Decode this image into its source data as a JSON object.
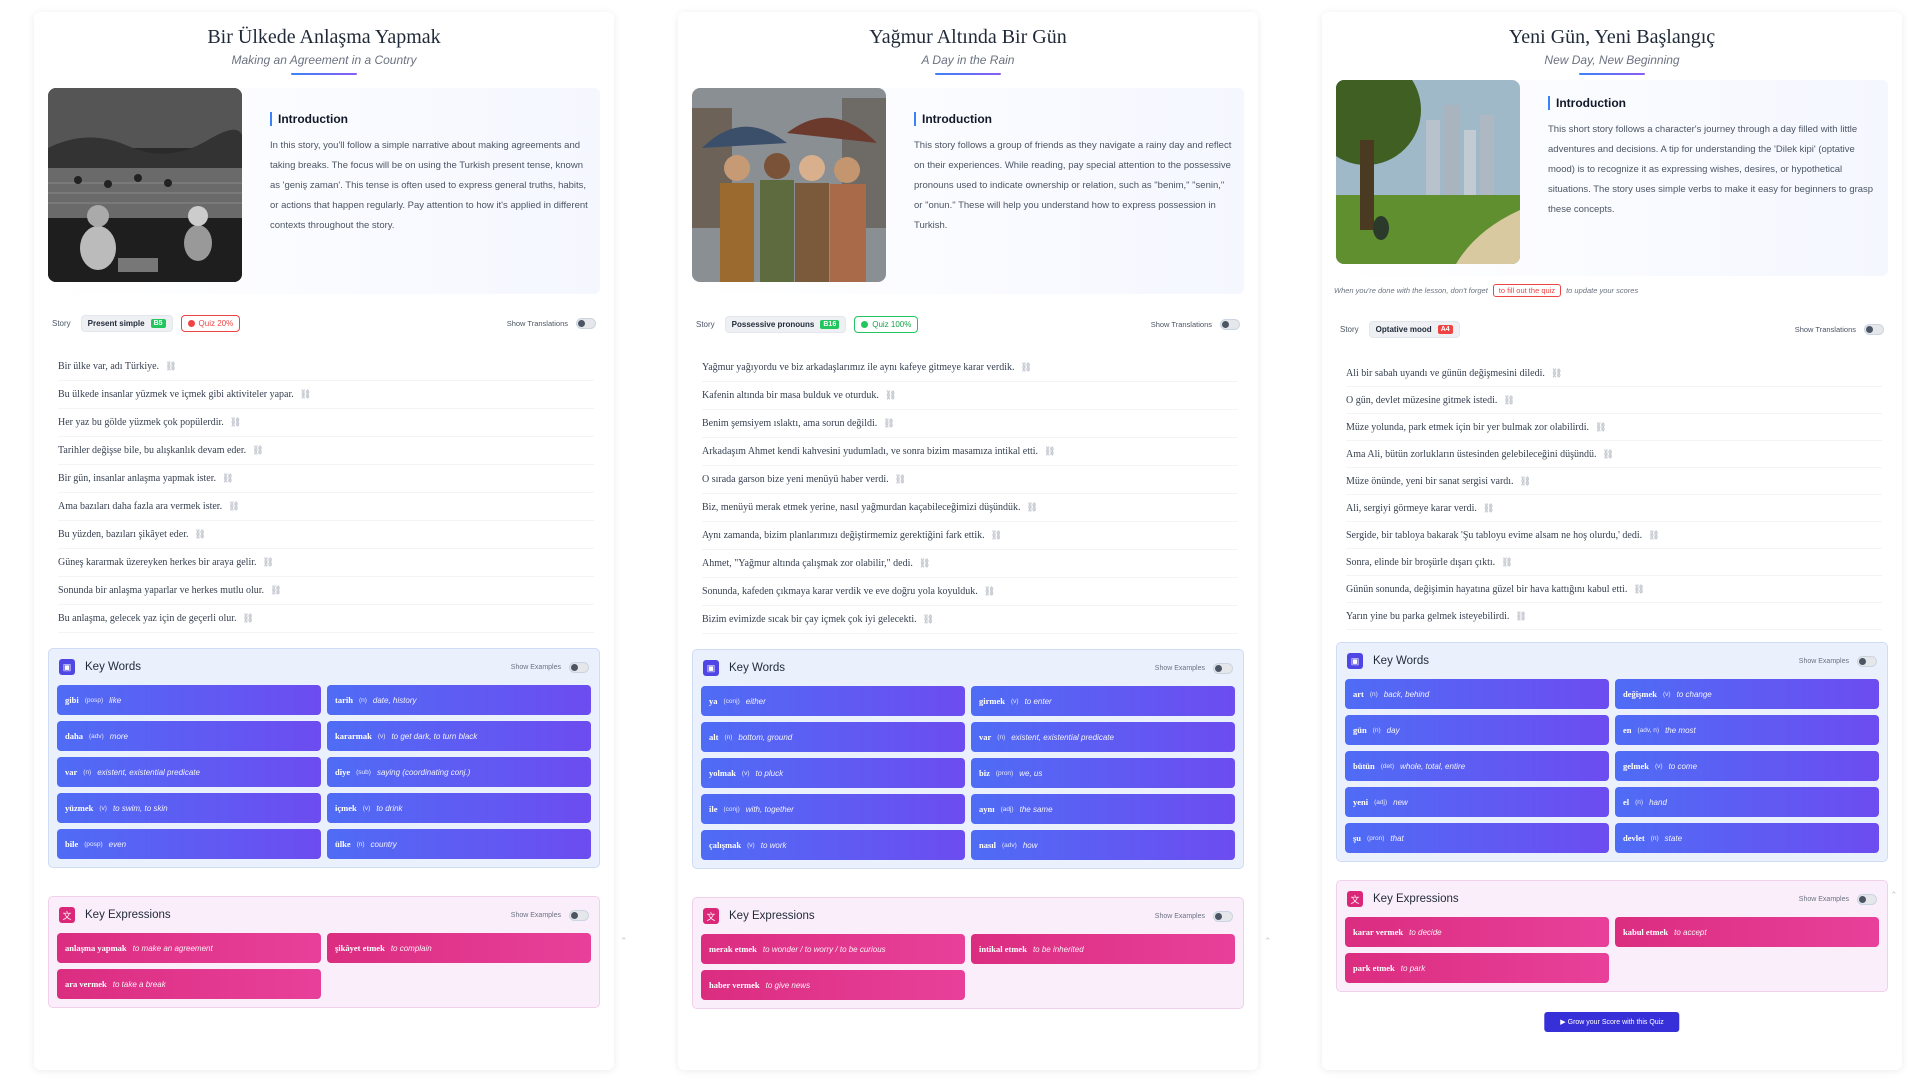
{
  "panels": [
    {
      "title": "Bir Ülkede Anlaşma Yapmak",
      "subtitle": "Making an Agreement in a Country",
      "intro_heading": "Introduction",
      "intro_text": "In this story, you'll follow a simple narrative about making agreements and taking breaks. The focus will be on using the Turkish present tense, known as 'geniş zaman'. This tense is often used to express general truths, habits, or actions that happen regularly. Pay attention to how it's applied in different contexts throughout the story.",
      "story_label": "Story",
      "grammar": "Present simple",
      "level": "B5",
      "quiz": "Quiz 20%",
      "show_translations": "Show Translations",
      "sentences": [
        "Bir ülke var, adı Türkiye.",
        "Bu ülkede insanlar yüzmek ve içmek gibi aktiviteler yapar.",
        "Her yaz bu gölde yüzmek çok popülerdir.",
        "Tarihler değişse bile, bu alışkanlık devam eder.",
        "Bir gün, insanlar anlaşma yapmak ister.",
        "Ama bazıları daha fazla ara vermek ister.",
        "Bu yüzden, bazıları şikâyet eder.",
        "Güneş kararmak üzereyken herkes bir araya gelir.",
        "Sonunda bir anlaşma yaparlar ve herkes mutlu olur.",
        "Bu anlaşma, gelecek yaz için de geçerli olur."
      ],
      "key_words_title": "Key Words",
      "show_examples": "Show Examples",
      "key_words": [
        {
          "word": "gibi",
          "pos": "(posp)",
          "meaning": "like"
        },
        {
          "word": "tarih",
          "pos": "(n)",
          "meaning": "date, history"
        },
        {
          "word": "daha",
          "pos": "(adv)",
          "meaning": "more"
        },
        {
          "word": "kararmak",
          "pos": "(v)",
          "meaning": "to get dark, to turn black"
        },
        {
          "word": "var",
          "pos": "(n)",
          "meaning": "existent, existential predicate"
        },
        {
          "word": "diye",
          "pos": "(sub)",
          "meaning": "saying (coordinating conj.)"
        },
        {
          "word": "yüzmek",
          "pos": "(v)",
          "meaning": "to swim, to skin"
        },
        {
          "word": "içmek",
          "pos": "(v)",
          "meaning": "to drink"
        },
        {
          "word": "bile",
          "pos": "(posp)",
          "meaning": "even"
        },
        {
          "word": "ülke",
          "pos": "(n)",
          "meaning": "country"
        }
      ],
      "key_expressions_title": "Key Expressions",
      "key_expressions": [
        {
          "word": "anlaşma yapmak",
          "meaning": "to make an agreement"
        },
        {
          "word": "şikâyet etmek",
          "meaning": "to complain"
        },
        {
          "word": "ara vermek",
          "meaning": "to take a break"
        }
      ]
    },
    {
      "title": "Yağmur Altında Bir Gün",
      "subtitle": "A Day in the Rain",
      "intro_heading": "Introduction",
      "intro_text": "This story follows a group of friends as they navigate a rainy day and reflect on their experiences. While reading, pay special attention to the possessive pronouns used to indicate ownership or relation, such as \"benim,\" \"senin,\" or \"onun.\" These will help you understand how to express possession in Turkish.",
      "story_label": "Story",
      "grammar": "Possessive pronouns",
      "level": "B16",
      "quiz": "Quiz 100%",
      "show_translations": "Show Translations",
      "sentences": [
        "Yağmur yağıyordu ve biz arkadaşlarımız ile aynı kafeye gitmeye karar verdik.",
        "Kafenin altında bir masa bulduk ve oturduk.",
        "Benim şemsiyem ıslaktı, ama sorun değildi.",
        "Arkadaşım Ahmet kendi kahvesini yudumladı, ve sonra bizim masamıza intikal etti.",
        "O sırada garson bize yeni menüyü haber verdi.",
        "Biz, menüyü merak etmek yerine, nasıl yağmurdan kaçabileceğimizi düşündük.",
        "Aynı zamanda, bizim planlarımızı değiştirmemiz gerektiğini fark ettik.",
        "Ahmet, \"Yağmur altında çalışmak zor olabilir,\" dedi.",
        "Sonunda, kafeden çıkmaya karar verdik ve eve doğru yola koyulduk.",
        "Bizim evimizde sıcak bir çay içmek çok iyi gelecekti."
      ],
      "key_words_title": "Key Words",
      "show_examples": "Show Examples",
      "key_words": [
        {
          "word": "ya",
          "pos": "(conj)",
          "meaning": "either"
        },
        {
          "word": "girmek",
          "pos": "(v)",
          "meaning": "to enter"
        },
        {
          "word": "alt",
          "pos": "(n)",
          "meaning": "bottom, ground"
        },
        {
          "word": "var",
          "pos": "(n)",
          "meaning": "existent, existential predicate"
        },
        {
          "word": "yolmak",
          "pos": "(v)",
          "meaning": "to pluck"
        },
        {
          "word": "biz",
          "pos": "(pron)",
          "meaning": "we, us"
        },
        {
          "word": "ile",
          "pos": "(conj)",
          "meaning": "with, together"
        },
        {
          "word": "aynı",
          "pos": "(adj)",
          "meaning": "the same"
        },
        {
          "word": "çalışmak",
          "pos": "(v)",
          "meaning": "to work"
        },
        {
          "word": "nasıl",
          "pos": "(adv)",
          "meaning": "how"
        }
      ],
      "key_expressions_title": "Key Expressions",
      "key_expressions": [
        {
          "word": "merak etmek",
          "meaning": "to wonder / to worry / to be curious"
        },
        {
          "word": "intikal etmek",
          "meaning": "to be inherited"
        },
        {
          "word": "haber vermek",
          "meaning": "to give news"
        }
      ]
    },
    {
      "title": "Yeni Gün, Yeni Başlangıç",
      "subtitle": "New Day, New Beginning",
      "intro_heading": "Introduction",
      "intro_text": "This short story follows a character's journey through a day filled with little adventures and decisions. A tip for understanding the 'Dilek kipi' (optative mood) is to recognize it as expressing wishes, desires, or hypothetical situations. The story uses simple verbs to make it easy for beginners to grasp these concepts.",
      "reminder_before": "When you're done with the lesson, don't forget",
      "reminder_link": "to fill out the quiz",
      "reminder_after": "to update your scores",
      "story_label": "Story",
      "grammar": "Optative mood",
      "level": "A4",
      "show_translations": "Show Translations",
      "sentences": [
        "Ali bir sabah uyandı ve günün değişmesini diledi.",
        "O gün, devlet müzesine gitmek istedi.",
        "Müze yolunda, park etmek için bir yer bulmak zor olabilirdi.",
        "Ama Ali, bütün zorlukların üstesinden gelebileceğini düşündü.",
        "Müze önünde, yeni bir sanat sergisi vardı.",
        "Ali, sergiyi görmeye karar verdi.",
        "Sergide, bir tabloya bakarak 'Şu tabloyu evime alsam ne hoş olurdu,' dedi.",
        "Sonra, elinde bir broşürle dışarı çıktı.",
        "Günün sonunda, değişimin hayatına güzel bir hava kattığını kabul etti.",
        "Yarın yine bu parka gelmek isteyebilirdi."
      ],
      "key_words_title": "Key Words",
      "show_examples": "Show Examples",
      "key_words": [
        {
          "word": "art",
          "pos": "(n)",
          "meaning": "back, behind"
        },
        {
          "word": "değişmek",
          "pos": "(v)",
          "meaning": "to change"
        },
        {
          "word": "gün",
          "pos": "(n)",
          "meaning": "day"
        },
        {
          "word": "en",
          "pos": "(adv, n)",
          "meaning": "the most"
        },
        {
          "word": "bütün",
          "pos": "(det)",
          "meaning": "whole, total, entire"
        },
        {
          "word": "gelmek",
          "pos": "(v)",
          "meaning": "to come"
        },
        {
          "word": "yeni",
          "pos": "(adj)",
          "meaning": "new"
        },
        {
          "word": "el",
          "pos": "(n)",
          "meaning": "hand"
        },
        {
          "word": "şu",
          "pos": "(pron)",
          "meaning": "that"
        },
        {
          "word": "devlet",
          "pos": "(n)",
          "meaning": "state"
        }
      ],
      "key_expressions_title": "Key Expressions",
      "key_expressions": [
        {
          "word": "karar vermek",
          "meaning": "to decide"
        },
        {
          "word": "kabul etmek",
          "meaning": "to accept"
        },
        {
          "word": "park etmek",
          "meaning": "to park"
        }
      ],
      "quiz_button": "Grow your Score with this Quiz"
    }
  ],
  "colors": {
    "accent_blue": "#4f46e5",
    "accent_pink": "#db2777",
    "level_green": "#22c55e",
    "level_red": "#ef4444",
    "quiz_red": "#ef4444",
    "quiz_green": "#22c55e"
  },
  "icons": {
    "link": "link-icon",
    "book": "book-icon",
    "translate": "translate-icon",
    "play": "play-icon"
  }
}
